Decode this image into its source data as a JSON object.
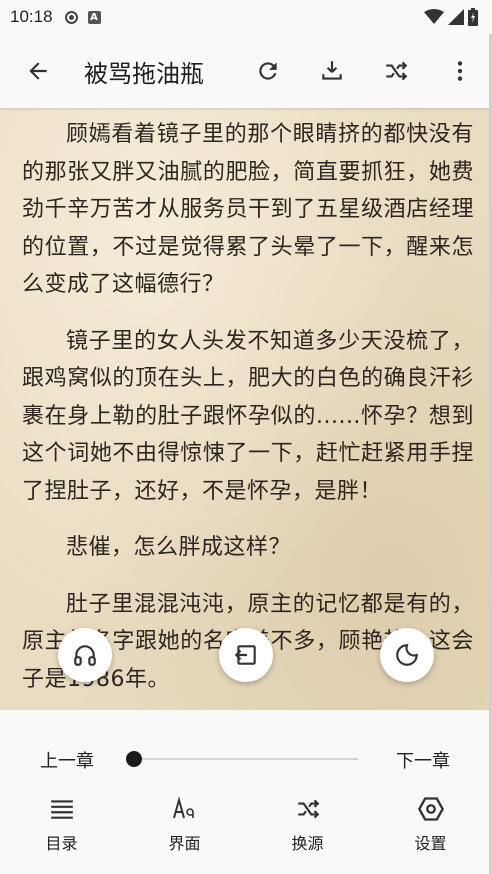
{
  "status_bar": {
    "time": "10:18"
  },
  "app_bar": {
    "title": "被骂拖油瓶",
    "icons": [
      "back-arrow-icon",
      "refresh-icon",
      "download-icon",
      "shuffle-icon",
      "more-vert-icon"
    ]
  },
  "content": {
    "paragraphs": [
      "顾嫣看着镜子里的那个眼睛挤的都快没有的那张又胖又油腻的肥脸，简直要抓狂，她费劲千辛万苦才从服务员干到了五星级酒店经理的位置，不过是觉得累了头晕了一下，醒来怎么变成了这幅德行？",
      "镜子里的女人头发不知道多少天没梳了，跟鸡窝似的顶在头上，肥大的白色的确良汗衫裹在身上勒的肚子跟怀孕似的......怀孕？想到这个词她不由得惊悚了一下，赶忙赶紧用手捏了捏肚子，还好，不是怀孕，是胖！",
      "悲催，怎么胖成这样？",
      "肚子里混混沌沌，原主的记忆都是有的，原主的名字跟她的名字差不多，顾艳艳，这会子是1986年。"
    ]
  },
  "floating_buttons": [
    "headphones-icon",
    "exit-to-app-icon",
    "night-mode-icon"
  ],
  "bottom_panel": {
    "prev_chapter": "上一章",
    "next_chapter": "下一章",
    "progress": 0.0,
    "menu": [
      {
        "label": "目录",
        "icon": "list-icon"
      },
      {
        "label": "界面",
        "icon": "text-format-icon"
      },
      {
        "label": "换源",
        "icon": "shuffle-icon"
      },
      {
        "label": "设置",
        "icon": "settings-icon"
      }
    ]
  }
}
